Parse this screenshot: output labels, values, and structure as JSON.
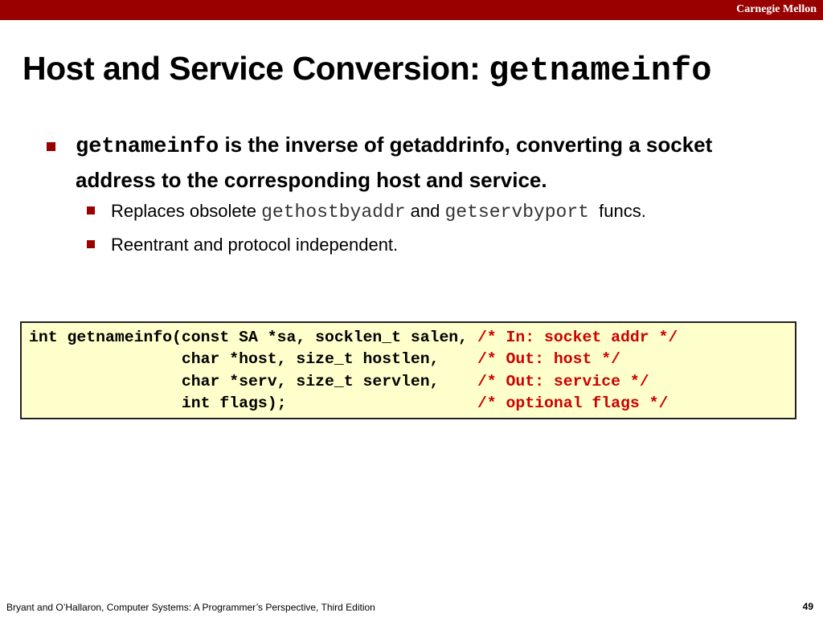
{
  "header": {
    "brand": "Carnegie Mellon",
    "bar_color": "#990000"
  },
  "title": {
    "text": "Host and Service Conversion: ",
    "code": "getnameinfo"
  },
  "bullet": {
    "code": "getnameinfo",
    "text": " is the inverse of getaddrinfo, converting a socket address to the corresponding host and service.",
    "subitems": [
      {
        "pre": "Replaces obsolete ",
        "code1": "gethostbyaddr",
        "mid": " and ",
        "code2": "getservbyport",
        "post": "  funcs."
      },
      {
        "text": "Reentrant and protocol independent."
      }
    ]
  },
  "code_box": {
    "lines": [
      {
        "code": "int getnameinfo(const SA *sa, socklen_t salen, ",
        "comment": "/* In: socket addr */"
      },
      {
        "code": "                char *host, size_t hostlen,    ",
        "comment": "/* Out: host */"
      },
      {
        "code": "                char *serv, size_t servlen,    ",
        "comment": "/* Out: service */"
      },
      {
        "code": "                int flags);                    ",
        "comment": "/* optional flags */"
      }
    ],
    "background": "#ffffcc",
    "comment_color": "#cc0000"
  },
  "footer": {
    "citation": "Bryant and O’Hallaron, Computer Systems: A Programmer’s Perspective, Third Edition",
    "page_number": "49"
  }
}
